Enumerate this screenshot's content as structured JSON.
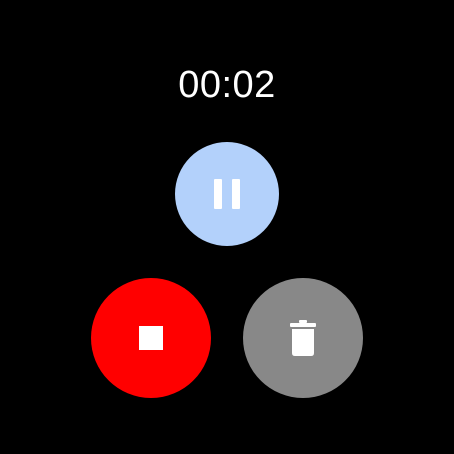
{
  "recorder": {
    "elapsed_time": "00:02"
  },
  "controls": {
    "pause": {
      "icon": "pause-icon",
      "color": "#b3d1fb"
    },
    "stop": {
      "icon": "stop-icon",
      "color": "#ff0000"
    },
    "delete": {
      "icon": "trash-icon",
      "color": "#888888"
    }
  }
}
